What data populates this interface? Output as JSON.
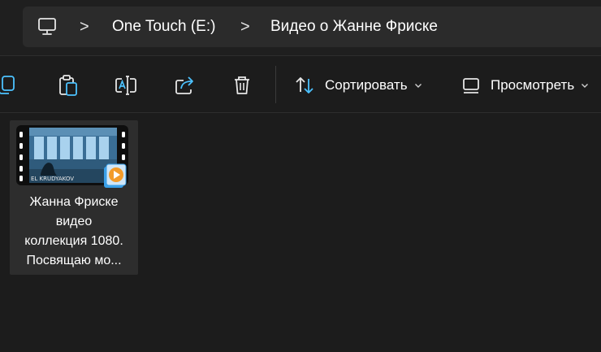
{
  "address": {
    "icon": "monitor-icon",
    "breadcrumbs": [
      "One Touch (E:)",
      "Видео о Жанне Фриске"
    ],
    "separator": ">"
  },
  "toolbar": {
    "icons": [
      "copy-icon",
      "paste-icon",
      "rename-icon",
      "share-icon",
      "delete-icon"
    ],
    "sort_label": "Сортировать",
    "view_label": "Просмотреть",
    "accent": "#4cc2ff"
  },
  "files": [
    {
      "name_lines": [
        "Жанна Фриске",
        "видео",
        "коллекция 1080.",
        "Посвящаю мо..."
      ],
      "thumb_caption": "EL KRUDYAKOV",
      "overlay_icon": "media-player-icon"
    }
  ]
}
